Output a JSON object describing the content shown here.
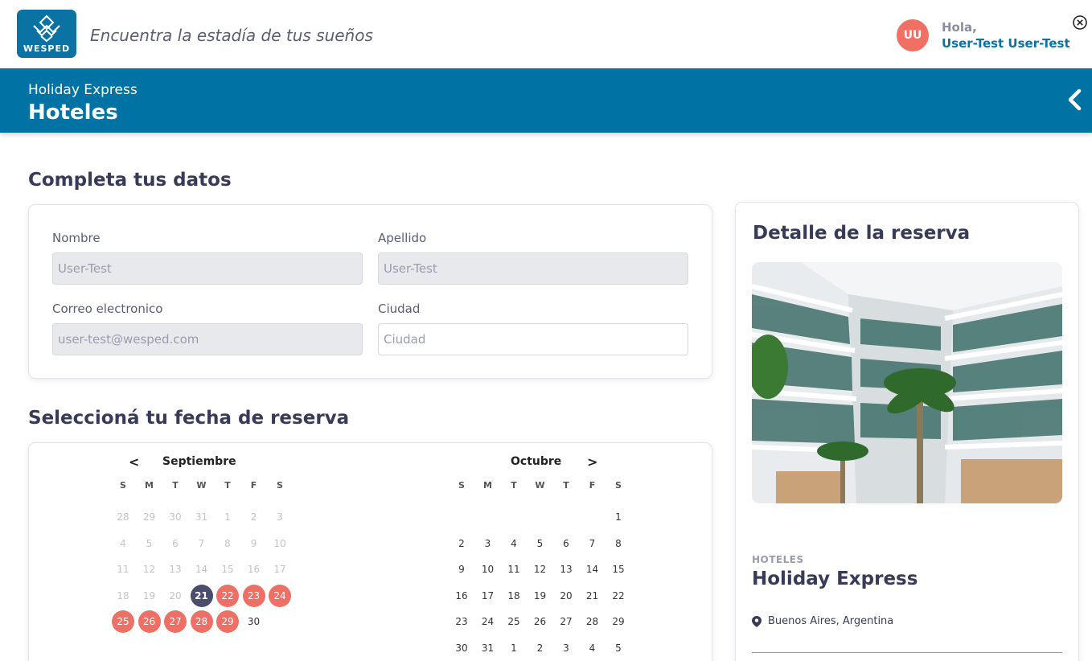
{
  "header": {
    "logo_text": "WESPED",
    "slogan": "Encuentra la estadía de tus sueños",
    "avatar_initials": "UU",
    "greeting": "Hola,",
    "user_name": "User-Test User-Test"
  },
  "banner": {
    "subtitle": "Holiday Express",
    "title": "Hoteles"
  },
  "form": {
    "section_title": "Completa tus datos",
    "nombre_label": "Nombre",
    "nombre_value": "User-Test",
    "apellido_label": "Apellido",
    "apellido_value": "User-Test",
    "email_label": "Correo electronico",
    "email_value": "user-test@wesped.com",
    "ciudad_label": "Ciudad",
    "ciudad_placeholder": "Ciudad"
  },
  "calendar": {
    "section_title": "Seleccioná tu fecha de reserva",
    "prev_label": "<",
    "next_label": ">",
    "weekdays": [
      "S",
      "M",
      "T",
      "W",
      "T",
      "F",
      "S"
    ],
    "months": [
      {
        "name": "Septiembre",
        "weeks": [
          [
            {
              "d": "28",
              "s": "muted"
            },
            {
              "d": "29",
              "s": "muted"
            },
            {
              "d": "30",
              "s": "muted"
            },
            {
              "d": "31",
              "s": "muted"
            },
            {
              "d": "1",
              "s": "muted"
            },
            {
              "d": "2",
              "s": "muted"
            },
            {
              "d": "3",
              "s": "muted"
            }
          ],
          [
            {
              "d": "4",
              "s": "muted"
            },
            {
              "d": "5",
              "s": "muted"
            },
            {
              "d": "6",
              "s": "muted"
            },
            {
              "d": "7",
              "s": "muted"
            },
            {
              "d": "8",
              "s": "muted"
            },
            {
              "d": "9",
              "s": "muted"
            },
            {
              "d": "10",
              "s": "muted"
            }
          ],
          [
            {
              "d": "11",
              "s": "muted"
            },
            {
              "d": "12",
              "s": "muted"
            },
            {
              "d": "13",
              "s": "muted"
            },
            {
              "d": "14",
              "s": "muted"
            },
            {
              "d": "15",
              "s": "muted"
            },
            {
              "d": "16",
              "s": "muted"
            },
            {
              "d": "17",
              "s": "muted"
            }
          ],
          [
            {
              "d": "18",
              "s": "muted"
            },
            {
              "d": "19",
              "s": "muted"
            },
            {
              "d": "20",
              "s": "muted"
            },
            {
              "d": "21",
              "s": "selected"
            },
            {
              "d": "22",
              "s": "range"
            },
            {
              "d": "23",
              "s": "range"
            },
            {
              "d": "24",
              "s": "range"
            }
          ],
          [
            {
              "d": "25",
              "s": "range"
            },
            {
              "d": "26",
              "s": "range"
            },
            {
              "d": "27",
              "s": "range"
            },
            {
              "d": "28",
              "s": "range"
            },
            {
              "d": "29",
              "s": "range"
            },
            {
              "d": "30",
              "s": "normal"
            },
            {
              "d": "",
              "s": "empty"
            }
          ]
        ]
      },
      {
        "name": "Octubre",
        "weeks": [
          [
            {
              "d": "",
              "s": "empty"
            },
            {
              "d": "",
              "s": "empty"
            },
            {
              "d": "",
              "s": "empty"
            },
            {
              "d": "",
              "s": "empty"
            },
            {
              "d": "",
              "s": "empty"
            },
            {
              "d": "",
              "s": "empty"
            },
            {
              "d": "1",
              "s": "normal"
            }
          ],
          [
            {
              "d": "2",
              "s": "normal"
            },
            {
              "d": "3",
              "s": "normal"
            },
            {
              "d": "4",
              "s": "normal"
            },
            {
              "d": "5",
              "s": "normal"
            },
            {
              "d": "6",
              "s": "normal"
            },
            {
              "d": "7",
              "s": "normal"
            },
            {
              "d": "8",
              "s": "normal"
            }
          ],
          [
            {
              "d": "9",
              "s": "normal"
            },
            {
              "d": "10",
              "s": "normal"
            },
            {
              "d": "11",
              "s": "normal"
            },
            {
              "d": "12",
              "s": "normal"
            },
            {
              "d": "13",
              "s": "normal"
            },
            {
              "d": "14",
              "s": "normal"
            },
            {
              "d": "15",
              "s": "normal"
            }
          ],
          [
            {
              "d": "16",
              "s": "normal"
            },
            {
              "d": "17",
              "s": "normal"
            },
            {
              "d": "18",
              "s": "normal"
            },
            {
              "d": "19",
              "s": "normal"
            },
            {
              "d": "20",
              "s": "normal"
            },
            {
              "d": "21",
              "s": "normal"
            },
            {
              "d": "22",
              "s": "normal"
            }
          ],
          [
            {
              "d": "23",
              "s": "normal"
            },
            {
              "d": "24",
              "s": "normal"
            },
            {
              "d": "25",
              "s": "normal"
            },
            {
              "d": "26",
              "s": "normal"
            },
            {
              "d": "27",
              "s": "normal"
            },
            {
              "d": "28",
              "s": "normal"
            },
            {
              "d": "29",
              "s": "normal"
            }
          ],
          [
            {
              "d": "30",
              "s": "normal"
            },
            {
              "d": "31",
              "s": "normal"
            },
            {
              "d": "1",
              "s": "normal"
            },
            {
              "d": "2",
              "s": "normal"
            },
            {
              "d": "3",
              "s": "normal"
            },
            {
              "d": "4",
              "s": "normal"
            },
            {
              "d": "5",
              "s": "normal"
            }
          ]
        ]
      }
    ]
  },
  "detail": {
    "title": "Detalle de la reserva",
    "category": "HOTELES",
    "hotel_name": "Holiday Express",
    "location": "Buenos Aires, Argentina"
  },
  "colors": {
    "brand": "#0073a4",
    "accent": "#ee6f64",
    "selected": "#4a4d6b"
  },
  "icons": {
    "close": "close-icon",
    "back": "chevron-left-icon",
    "location": "location-pin-icon"
  }
}
